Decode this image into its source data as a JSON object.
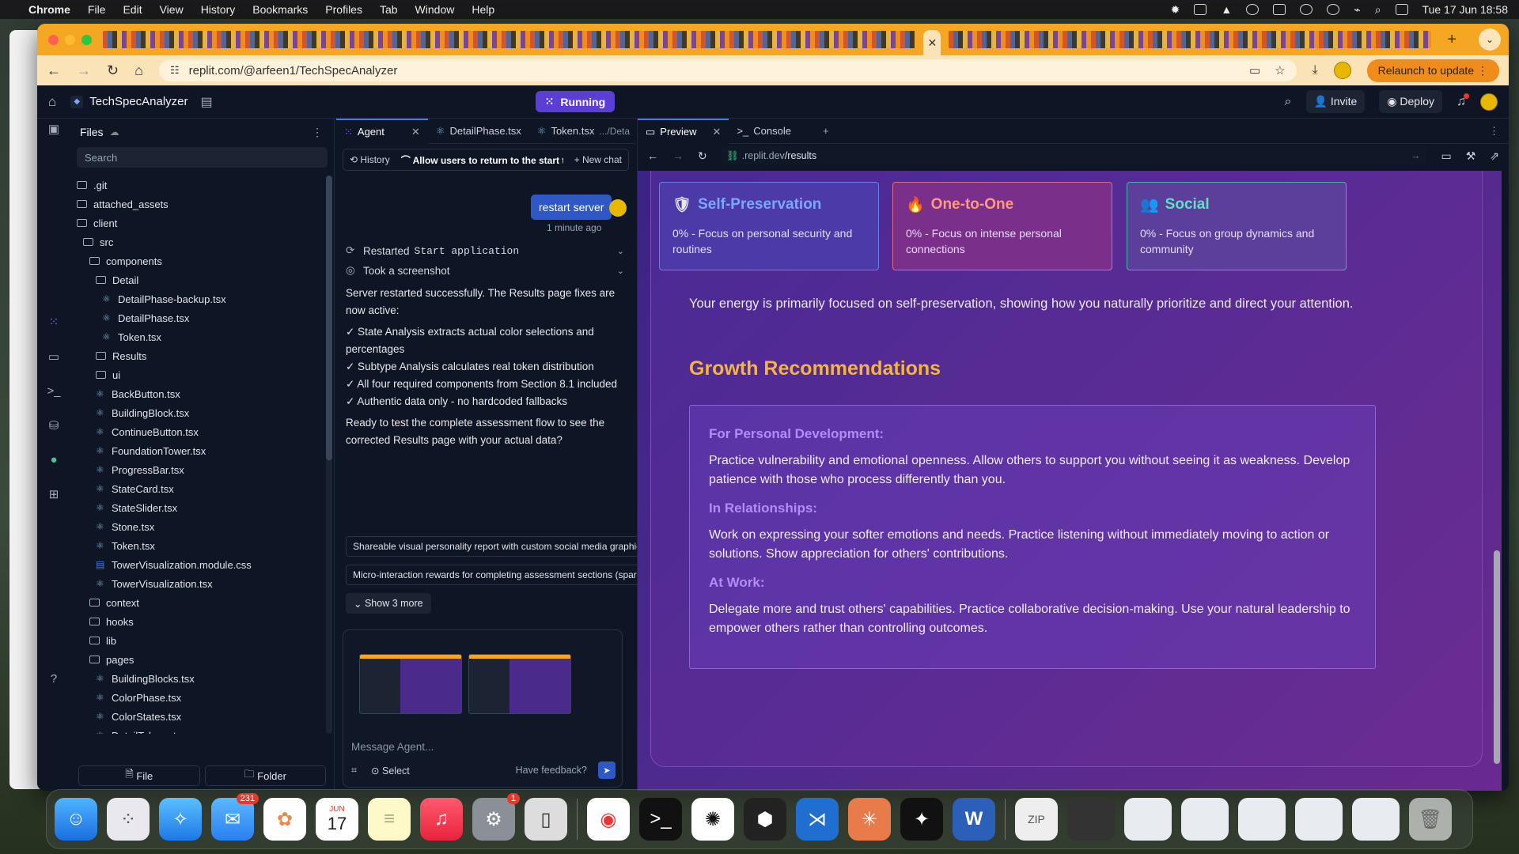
{
  "menubar": {
    "app": "Chrome",
    "items": [
      "File",
      "Edit",
      "View",
      "History",
      "Bookmarks",
      "Profiles",
      "Tab",
      "Window",
      "Help"
    ],
    "clock": "Tue 17 Jun  18:58"
  },
  "browser": {
    "url": "replit.com/@arfeen1/TechSpecAnalyzer",
    "relaunch": "Relaunch to update"
  },
  "replit": {
    "project": "TechSpecAnalyzer",
    "status": "Running",
    "invite": "Invite",
    "deploy": "Deploy"
  },
  "files": {
    "title": "Files",
    "search_placeholder": "Search",
    "new_file": "File",
    "new_folder": "Folder",
    "tree": [
      {
        "name": ".git",
        "type": "folder",
        "depth": 0
      },
      {
        "name": "attached_assets",
        "type": "folder",
        "depth": 0
      },
      {
        "name": "client",
        "type": "folder",
        "depth": 0
      },
      {
        "name": "src",
        "type": "folder",
        "depth": 1
      },
      {
        "name": "components",
        "type": "folder",
        "depth": 2
      },
      {
        "name": "Detail",
        "type": "folder",
        "depth": 3
      },
      {
        "name": "DetailPhase-backup.tsx",
        "type": "react",
        "depth": 4
      },
      {
        "name": "DetailPhase.tsx",
        "type": "react",
        "depth": 4
      },
      {
        "name": "Token.tsx",
        "type": "react",
        "depth": 4
      },
      {
        "name": "Results",
        "type": "folder",
        "depth": 3
      },
      {
        "name": "ui",
        "type": "folder",
        "depth": 3
      },
      {
        "name": "BackButton.tsx",
        "type": "react",
        "depth": 3
      },
      {
        "name": "BuildingBlock.tsx",
        "type": "react",
        "depth": 3
      },
      {
        "name": "ContinueButton.tsx",
        "type": "react",
        "depth": 3
      },
      {
        "name": "FoundationTower.tsx",
        "type": "react",
        "depth": 3
      },
      {
        "name": "ProgressBar.tsx",
        "type": "react",
        "depth": 3
      },
      {
        "name": "StateCard.tsx",
        "type": "react",
        "depth": 3
      },
      {
        "name": "StateSlider.tsx",
        "type": "react",
        "depth": 3
      },
      {
        "name": "Stone.tsx",
        "type": "react",
        "depth": 3
      },
      {
        "name": "Token.tsx",
        "type": "react",
        "depth": 3
      },
      {
        "name": "TowerVisualization.module.css",
        "type": "css",
        "depth": 3
      },
      {
        "name": "TowerVisualization.tsx",
        "type": "react",
        "depth": 3
      },
      {
        "name": "context",
        "type": "folder",
        "depth": 2
      },
      {
        "name": "hooks",
        "type": "folder",
        "depth": 2
      },
      {
        "name": "lib",
        "type": "folder",
        "depth": 2
      },
      {
        "name": "pages",
        "type": "folder",
        "depth": 2
      },
      {
        "name": "BuildingBlocks.tsx",
        "type": "react",
        "depth": 3
      },
      {
        "name": "ColorPhase.tsx",
        "type": "react",
        "depth": 3
      },
      {
        "name": "ColorStates.tsx",
        "type": "react",
        "depth": 3
      },
      {
        "name": "DetailTokens.tsx",
        "type": "react",
        "depth": 3
      }
    ]
  },
  "agent": {
    "tabs": {
      "agent": "Agent",
      "detail": "DetailPhase.tsx",
      "token": "Token.tsx",
      "token_path": ".../Deta"
    },
    "history": "History",
    "thread": "Allow users to return to the start to reasse...",
    "new_chat": "New chat",
    "user_msg": "restart server",
    "time": "1 minute ago",
    "action1": "Restarted",
    "action1_code": "Start application",
    "action2": "Took a screenshot",
    "reply": "Server restarted successfully. The Results page fixes are now active:",
    "checks": [
      "✓ State Analysis extracts actual color selections and percentages",
      "✓ Subtype Analysis calculates real token distribution",
      "✓ All four required components from Section 8.1 included",
      "✓ Authentic data only - no hardcoded fallbacks"
    ],
    "question": "Ready to test the complete assessment flow to see the corrected Results page with your actual data?",
    "suggestions": [
      "Shareable visual personality report with custom social media graphics",
      "Micro-interaction rewards for completing assessment sections (sparkl..."
    ],
    "show_more": "Show 3 more",
    "placeholder": "Message Agent...",
    "select": "Select",
    "feedback": "Have feedback?"
  },
  "preview": {
    "tab": "Preview",
    "console": "Console",
    "url_prefix": ".replit.dev",
    "url_path": "/results",
    "cards": [
      {
        "title": "Self-Preservation",
        "text": "0% - Focus on personal security and routines",
        "color": "#7ba7ff",
        "icon": "shield-icon"
      },
      {
        "title": "One-to-One",
        "text": "0% - Focus on intense personal connections",
        "color": "#ff9a7a",
        "icon": "fire-icon"
      },
      {
        "title": "Social",
        "text": "0% - Focus on group dynamics and community",
        "color": "#5ee0c4",
        "icon": "people-icon"
      }
    ],
    "energy": "Your energy is primarily focused on self-preservation, showing how you naturally prioritize and direct your attention.",
    "growth_title": "Growth Recommendations",
    "recs": [
      {
        "h": "For Personal Development:",
        "p": "Practice vulnerability and emotional openness. Allow others to support you without seeing it as weakness. Develop patience with those who process differently than you."
      },
      {
        "h": "In Relationships:",
        "p": "Work on expressing your softer emotions and needs. Practice listening without immediately moving to action or solutions. Show appreciation for others' contributions."
      },
      {
        "h": "At Work:",
        "p": "Delegate more and trust others' capabilities. Practice collaborative decision-making. Use your natural leadership to empower others rather than controlling outcomes."
      }
    ]
  },
  "dock": {
    "mail_badge": "231",
    "settings_badge": "1",
    "calendar_month": "JUN",
    "calendar_day": "17"
  }
}
